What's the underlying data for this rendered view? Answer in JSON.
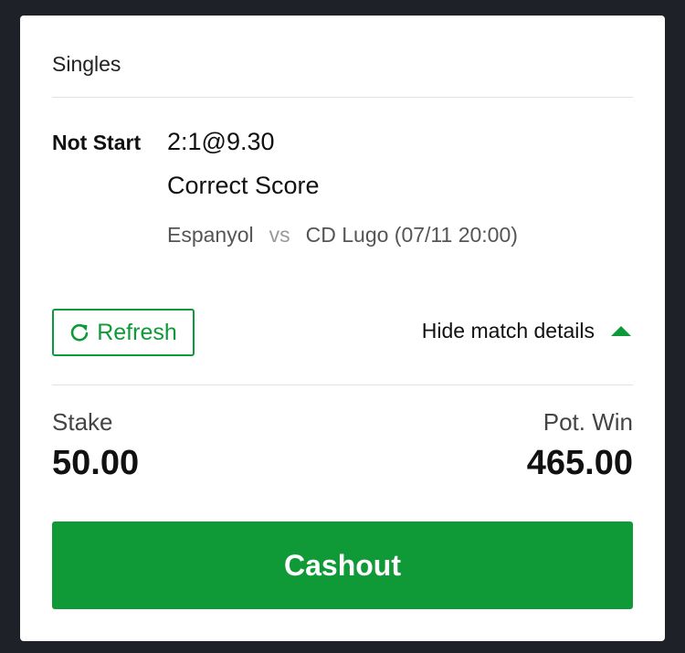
{
  "header": {
    "title": "Singles"
  },
  "bet": {
    "status": "Not Start",
    "selection": "2:1@9.30",
    "market": "Correct Score",
    "home_team": "Espanyol",
    "vs_label": "vs",
    "away_team_time": "CD Lugo (07/11 20:00)"
  },
  "actions": {
    "refresh_label": "Refresh",
    "toggle_details_label": "Hide match details"
  },
  "summary": {
    "stake_label": "Stake",
    "stake_value": "50.00",
    "potwin_label": "Pot. Win",
    "potwin_value": "465.00"
  },
  "cashout": {
    "label": "Cashout"
  },
  "icons": {
    "refresh": "refresh-icon",
    "toggle": "caret-up-icon"
  },
  "colors": {
    "accent": "#0e9a3a",
    "button": "#109a37",
    "background": "#1e2128"
  }
}
